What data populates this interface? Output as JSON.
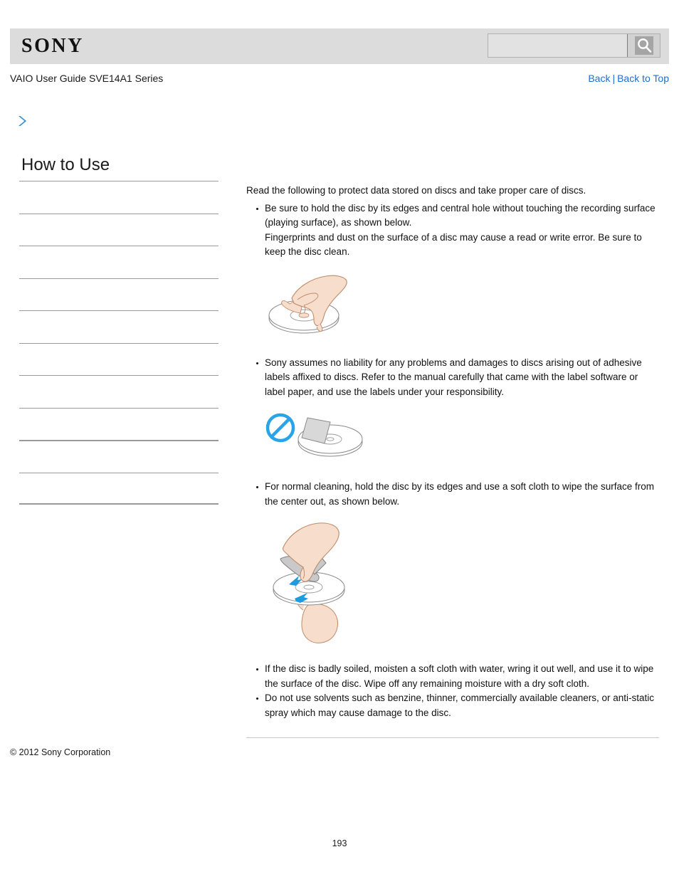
{
  "header": {
    "logo_text": "SONY",
    "search": {
      "value": "",
      "placeholder": "",
      "button_icon": "search-icon"
    }
  },
  "subheader": {
    "guide_title": "VAIO User Guide SVE14A1 Series",
    "back_label": "Back",
    "separator": "|",
    "back_to_top_label": "Back to Top"
  },
  "breadcrumb": {
    "icon": "chevron-right-icon",
    "text": ""
  },
  "sidebar": {
    "heading": "How to Use",
    "items": [
      {
        "label": ""
      },
      {
        "label": ""
      },
      {
        "label": ""
      },
      {
        "label": ""
      },
      {
        "label": ""
      },
      {
        "label": ""
      },
      {
        "label": ""
      },
      {
        "label": ""
      },
      {
        "label": ""
      },
      {
        "label": ""
      }
    ]
  },
  "main": {
    "intro": "Read the following to protect data stored on discs and take proper care of discs.",
    "bullets": [
      {
        "text": "Be sure to hold the disc by its edges and central hole without touching the recording surface (playing surface), as shown below.\nFingerprints and dust on the surface of a disc may cause a read or write error. Be sure to keep the disc clean.",
        "figure": "hand-holding-disc-illustration"
      },
      {
        "text": "Sony assumes no liability for any problems and damages to discs arising out of adhesive labels affixed to discs. Refer to the manual carefully that came with the label software or label paper, and use the labels under your responsibility.",
        "figure": "no-adhesive-label-on-disc-illustration"
      },
      {
        "text": "For normal cleaning, hold the disc by its edges and use a soft cloth to wipe the surface from the center out, as shown below.",
        "figure": "wiping-disc-with-cloth-illustration"
      },
      {
        "text": "If the disc is badly soiled, moisten a soft cloth with water, wring it out well, and use it to wipe the surface of the disc. Wipe off any remaining moisture with a dry soft cloth.",
        "figure": ""
      },
      {
        "text": "Do not use solvents such as benzine, thinner, commercially available cleaners, or anti-static spray which may cause damage to the disc.",
        "figure": ""
      }
    ]
  },
  "footer": {
    "copyright": "© 2012 Sony Corporation",
    "page_number": "193"
  },
  "colors": {
    "link_blue": "#1a6fd0",
    "chevron_blue": "#2b8fd1",
    "header_band": "#dcdcdc",
    "rule_gray": "#9a9a9a",
    "skin": "#f6ddcc",
    "cloth_gray": "#c9c9c9",
    "arrow_blue": "#1e9bdf"
  }
}
